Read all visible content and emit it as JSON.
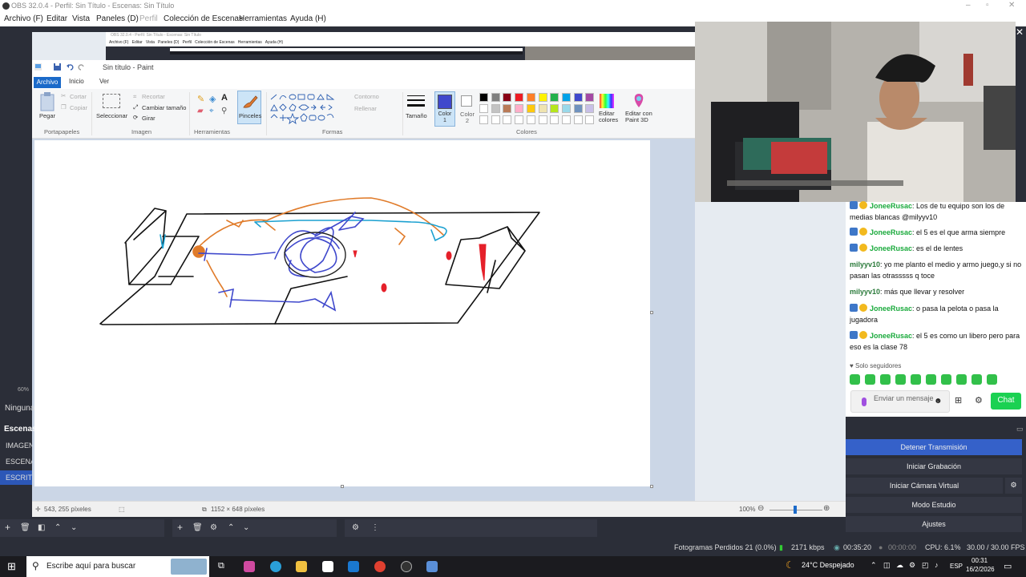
{
  "obs": {
    "title": "OBS 32.0.4 - Perfil: Sin Título - Escenas: Sin Título",
    "menu": [
      "Archivo (F)",
      "Editar",
      "Vista",
      "Paneles (D)",
      "Perfil",
      "Colección de Escenas",
      "Herramientas",
      "Ayuda (H)"
    ],
    "zoom_label": "60%",
    "ninguna": "Ninguna",
    "scenes_header": "Escenas",
    "scenes": [
      "IMAGEN",
      "ESCENA",
      "ESCRITORIO"
    ],
    "controls": [
      "Detener Transmisión",
      "Iniciar Grabación",
      "Iniciar Cámara Virtual",
      "Modo Estudio",
      "Ajustes"
    ],
    "status": {
      "dropped": "Fotogramas Perdidos 21 (0.0%)",
      "bitrate": "2171 kbps",
      "stream_time": "00:35:20",
      "rec_time": "00:00:00",
      "cpu": "CPU: 6.1%",
      "fps": "30.00 / 30.00 FPS"
    }
  },
  "paint": {
    "title": "Sin título - Paint",
    "tabs": [
      "Archivo",
      "Inicio",
      "Ver"
    ],
    "ribbon": {
      "pegar": "Pegar",
      "cortar": "Cortar",
      "copiar": "Copiar",
      "portapapeles": "Portapapeles",
      "seleccionar": "Seleccionar",
      "recortar": "Recortar",
      "cambiar_tamano": "Cambiar tamaño",
      "girar": "Girar",
      "imagen": "Imagen",
      "herramientas": "Herramientas",
      "pinceles": "Pinceles",
      "contorno": "Contorno",
      "rellenar": "Rellenar",
      "formas": "Formas",
      "tamano": "Tamaño",
      "color1": "Color 1",
      "color2": "Color 2",
      "colores": "Colores",
      "editar_colores": "Editar colores",
      "editar_paint3d": "Editar con Paint 3D"
    },
    "palette_row1": [
      "#000000",
      "#7f7f7f",
      "#880015",
      "#ed1c24",
      "#ff7f27",
      "#fff200",
      "#22b14c",
      "#00a2e8",
      "#3f48cc",
      "#a349a4"
    ],
    "palette_row2": [
      "#ffffff",
      "#c3c3c3",
      "#b97a57",
      "#ffaec9",
      "#ffc90e",
      "#efe4b0",
      "#b5e61d",
      "#99d9ea",
      "#7092be",
      "#c8bfe7"
    ],
    "color1_value": "#3f48cc",
    "status_pos": "543, 255 píxeles",
    "status_size": "1152 × 648 píxeles",
    "status_zoom": "100%"
  },
  "chat": {
    "messages": [
      {
        "user": "JoneeRusac",
        "text": "Los de tu equipo son los de medias blancas @milyyv10",
        "badges": true
      },
      {
        "user": "JoneeRusac",
        "text": "el 5 es el que arma siempre",
        "badges": true
      },
      {
        "user": "JoneeRusac",
        "text": "es el de lentes",
        "badges": true
      },
      {
        "user": "milyyv10",
        "text": "yo me planto el medio y armo juego,y si no pasan las otrasssss q toce",
        "badges": false
      },
      {
        "user": "milyyv10",
        "text": "más que llevar y resolver",
        "badges": false
      },
      {
        "user": "JoneeRusac",
        "text": "o pasa la pelota o pasa la jugadora",
        "badges": true
      },
      {
        "user": "JoneeRusac",
        "text": "el 5 es como un libero pero para eso es la clase 78",
        "badges": true
      }
    ],
    "followers_only": "Solo seguidores",
    "placeholder": "Enviar un mensaje",
    "chat_button": "Chat"
  },
  "taskbar": {
    "search_placeholder": "Escribe aquí para buscar",
    "weather": "24°C  Despejado",
    "lang": "ESP",
    "time": "00:31",
    "date": "16/2/2026"
  }
}
